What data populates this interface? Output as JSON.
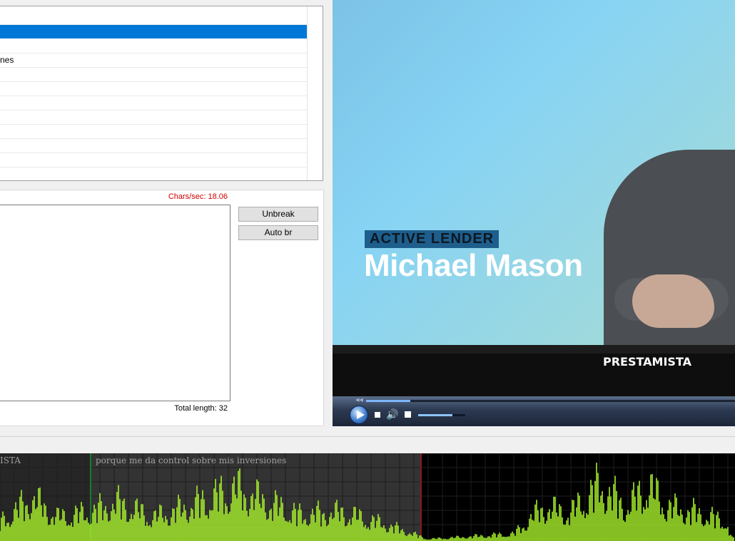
{
  "grid": {
    "rows": [
      {
        "text": ""
      },
      {
        "text": "",
        "selected": true
      },
      {
        "text": ""
      },
      {
        "text": "nes"
      },
      {
        "text": ""
      },
      {
        "text": ""
      },
      {
        "text": ""
      },
      {
        "text": ""
      },
      {
        "text": ""
      },
      {
        "text": ""
      },
      {
        "text": ""
      },
      {
        "text": ""
      }
    ]
  },
  "editor": {
    "chars_per_sec": "Chars/sec: 18.06",
    "total_length": "Total length: 32",
    "text_value": "",
    "buttons": {
      "unbreak": "Unbreak",
      "auto_br": "Auto br"
    }
  },
  "video": {
    "lower_third_tag": "ACTIVE LENDER",
    "lower_third_name": "Michael Mason",
    "subtitle": "PRESTAMISTA"
  },
  "player": {
    "progress": 0.12,
    "volume": 0.73,
    "rewind_glyph": "◀◀",
    "volume_glyph": "🔊"
  },
  "waveform": {
    "labels": [
      {
        "text": "ISTA"
      },
      {
        "text": "porque me da control sobre mis inversiones"
      }
    ],
    "colors": {
      "wave": "#a6ee2a",
      "selection": "#333333",
      "grid": "#1e1e1e",
      "boundary": "#8b1a1a"
    }
  }
}
